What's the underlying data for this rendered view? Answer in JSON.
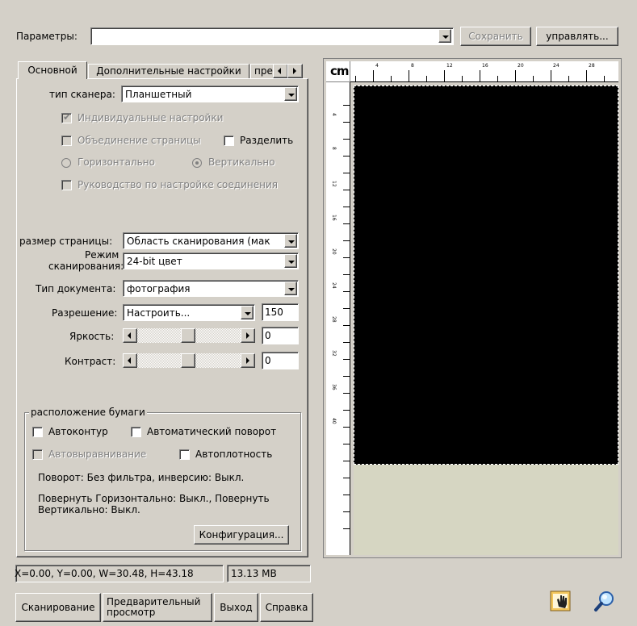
{
  "top": {
    "params_label": "Параметры:",
    "params_value": "",
    "save_label": "Сохранить",
    "manage_label": "управлять..."
  },
  "tabs": [
    {
      "label": "Основной"
    },
    {
      "label": "Дополнительные настройки"
    },
    {
      "label": "пре"
    }
  ],
  "basic": {
    "scanner_type_label": "тип сканера:",
    "scanner_type_value": "Планшетный",
    "individual_settings": "Индивидуальные настройки",
    "merge_pages": "Объединение страницы",
    "split": "Разделить",
    "horizontal": "Горизонтально",
    "vertical": "Вертикально",
    "connection_guide": "Руководство по настройке соединения",
    "page_size_label": "размер страницы:",
    "page_size_value": "Область сканирования (мак",
    "scan_mode_label_1": "Режим",
    "scan_mode_label_2": "сканирования:",
    "scan_mode_value": "24-bit цвет",
    "doc_type_label": "Тип документа:",
    "doc_type_value": "фотография",
    "resolution_label": "Разрешение:",
    "resolution_value": "Настроить...",
    "resolution_number": "150",
    "brightness_label": "Яркость:",
    "brightness_value": "0",
    "contrast_label": "Контраст:",
    "contrast_value": "0"
  },
  "paper": {
    "group_label": "расположение бумаги",
    "autocontour": "Автоконтур",
    "autorotate": "Автоматический поворот",
    "autoalign": "Автовыравнивание",
    "autodensity": "Автоплотность",
    "rotation_info": "Поворот: Без фильтра, инверсию: Выкл.",
    "flip_info_1": "Повернуть Горизонтально: Выкл., Повернуть",
    "flip_info_2": "Вертикально: Выкл.",
    "config_label": "Конфигурация..."
  },
  "status": {
    "coords": "X=0.00, Y=0.00, W=30.48, H=43.18",
    "size": "13.13 MB"
  },
  "buttons": {
    "scan": "Сканирование",
    "preview_1": "Предварительный",
    "preview_2": "просмотр",
    "exit": "Выход",
    "help": "Справка"
  },
  "ruler": {
    "unit": "cm",
    "top_labels": [
      "4",
      "8",
      "12",
      "16",
      "20",
      "24",
      "28"
    ],
    "left_labels": [
      "4",
      "8",
      "12",
      "16",
      "20",
      "24",
      "28",
      "32",
      "36",
      "40"
    ]
  },
  "icons": [
    "scanner-hand-icon",
    "zoom-icon"
  ]
}
